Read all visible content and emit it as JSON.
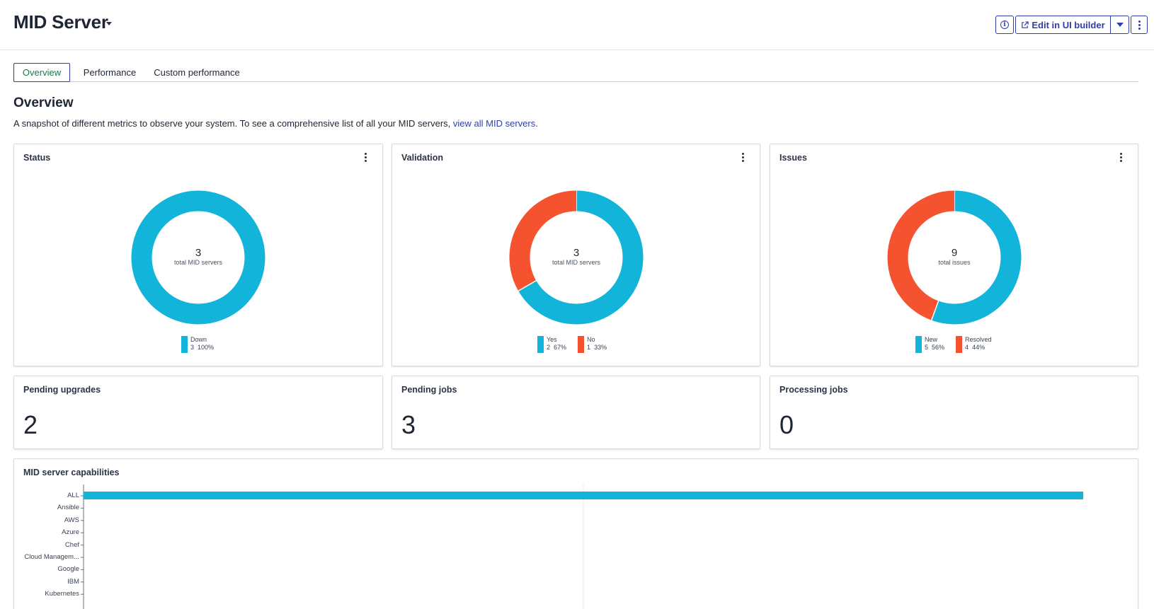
{
  "header": {
    "title": "MID Server",
    "edit_label": "Edit in UI builder"
  },
  "tabs": [
    {
      "label": "Overview"
    },
    {
      "label": "Performance"
    },
    {
      "label": "Custom performance"
    }
  ],
  "overview": {
    "title": "Overview",
    "description": "A snapshot of different metrics to observe your system. To see a comprehensive list of all your MID servers, ",
    "link_text": "view all MID servers",
    "description_end": "."
  },
  "colors": {
    "cyan": "#12b5d9",
    "orange": "#f5532f",
    "accent": "#2f3fa6"
  },
  "status_card": {
    "title": "Status",
    "center_value": "3",
    "center_label": "total MID servers",
    "legend": [
      {
        "name": "Down",
        "count": "3",
        "percent": "100%"
      }
    ]
  },
  "validation_card": {
    "title": "Validation",
    "center_value": "3",
    "center_label": "total MID servers",
    "legend": [
      {
        "name": "Yes",
        "count": "2",
        "percent": "67%"
      },
      {
        "name": "No",
        "count": "1",
        "percent": "33%"
      }
    ]
  },
  "issues_card": {
    "title": "Issues",
    "center_value": "9",
    "center_label": "total issues",
    "legend": [
      {
        "name": "New",
        "count": "5",
        "percent": "56%"
      },
      {
        "name": "Resolved",
        "count": "4",
        "percent": "44%"
      }
    ]
  },
  "pending_upgrades": {
    "title": "Pending upgrades",
    "value": "2"
  },
  "pending_jobs": {
    "title": "Pending jobs",
    "value": "3"
  },
  "processing_jobs": {
    "title": "Processing jobs",
    "value": "0"
  },
  "capabilities": {
    "title": "MID server capabilities"
  },
  "chart_data": [
    {
      "type": "pie",
      "title": "Status",
      "slices": [
        {
          "label": "Down",
          "value": 3,
          "percent": 100,
          "color": "#12b5d9"
        }
      ],
      "total": 3
    },
    {
      "type": "pie",
      "title": "Validation",
      "slices": [
        {
          "label": "Yes",
          "value": 2,
          "percent": 67,
          "color": "#12b5d9"
        },
        {
          "label": "No",
          "value": 1,
          "percent": 33,
          "color": "#f5532f"
        }
      ],
      "total": 3
    },
    {
      "type": "pie",
      "title": "Issues",
      "slices": [
        {
          "label": "New",
          "value": 5,
          "percent": 56,
          "color": "#12b5d9"
        },
        {
          "label": "Resolved",
          "value": 4,
          "percent": 44,
          "color": "#f5532f"
        }
      ],
      "total": 9
    },
    {
      "type": "bar",
      "orientation": "horizontal",
      "title": "MID server capabilities",
      "categories": [
        "ALL",
        "Ansible",
        "AWS",
        "Azure",
        "Chef",
        "Cloud Managem...",
        "Google",
        "IBM",
        "Kubernetes"
      ],
      "values": [
        1,
        0,
        0,
        0,
        0,
        0,
        0,
        0,
        0
      ],
      "xlim": [
        0,
        1
      ],
      "color": "#12b5d9"
    }
  ]
}
